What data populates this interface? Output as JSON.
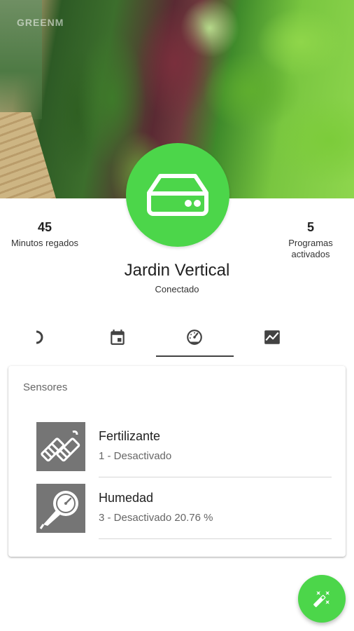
{
  "header": {
    "brand": "GREENM",
    "device_icon": "hard-drive-icon",
    "accent_color": "#4cd64a"
  },
  "stats": {
    "left": {
      "value": "45",
      "label": "Minutos regados"
    },
    "right": {
      "value": "5",
      "label_line1": "Programas",
      "label_line2": "activados"
    }
  },
  "device": {
    "name": "Jardin Vertical",
    "status": "Conectado"
  },
  "tabs": [
    {
      "icon": "info-icon",
      "selected": false
    },
    {
      "icon": "calendar-icon",
      "selected": false
    },
    {
      "icon": "speedometer-icon",
      "selected": true
    },
    {
      "icon": "chart-icon",
      "selected": false
    }
  ],
  "sensors": {
    "title": "Sensores",
    "items": [
      {
        "name": "Fertilizante",
        "desc": "1 - Desactivado",
        "icon": "fertilizer-icon"
      },
      {
        "name": "Humedad",
        "desc": "3 - Desactivado 20.76 %",
        "icon": "humidity-gauge-icon"
      }
    ]
  },
  "fab": {
    "icon": "magic-wand-icon"
  }
}
